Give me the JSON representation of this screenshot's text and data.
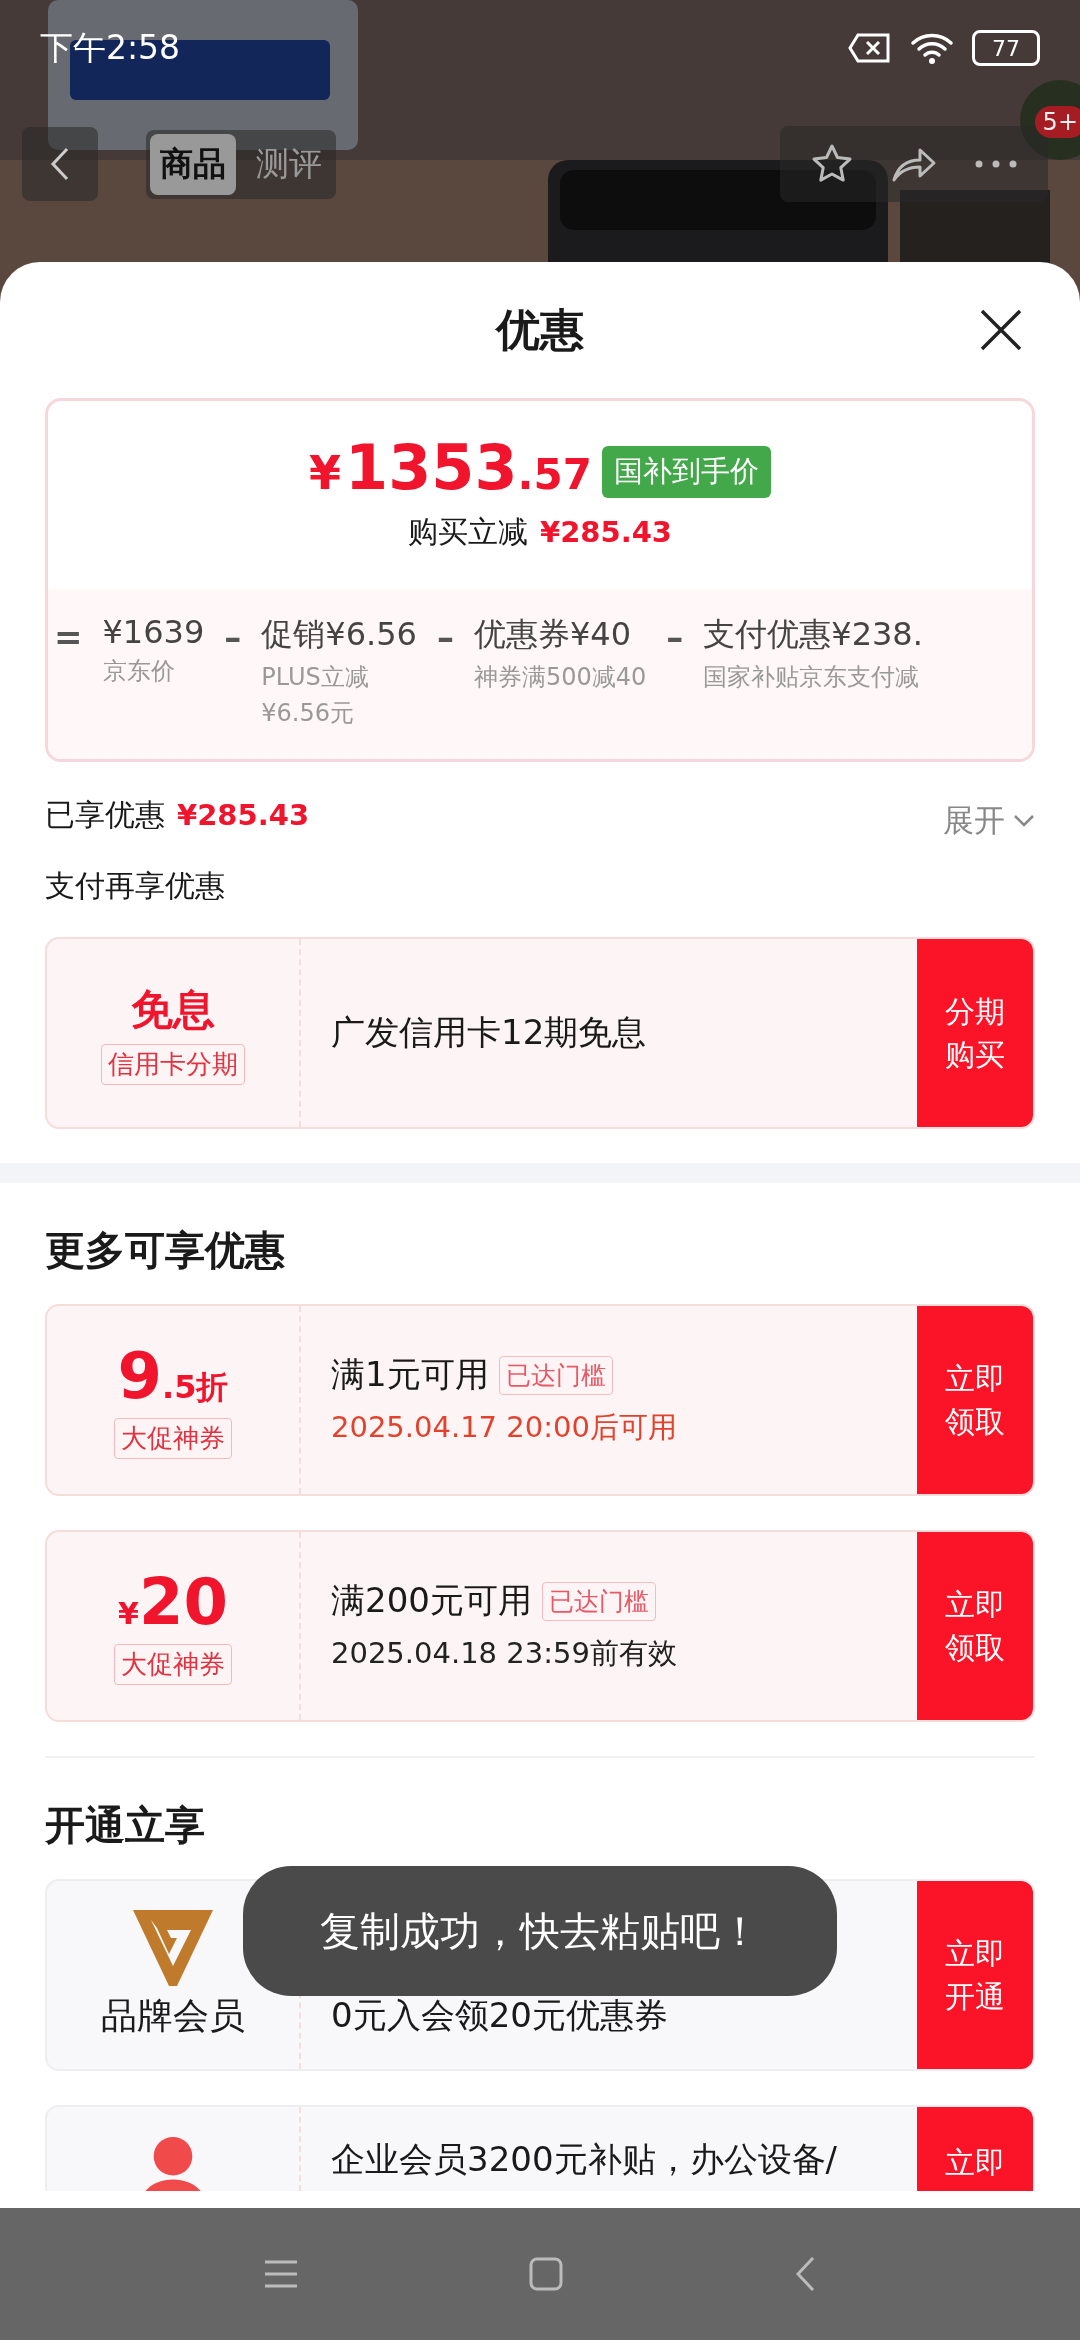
{
  "status_bar": {
    "time": "下午2:58",
    "battery": "77"
  },
  "header": {
    "tabs": [
      {
        "label": "商品",
        "selected": true
      },
      {
        "label": "测评",
        "selected": false
      }
    ],
    "badge": "5+"
  },
  "sheet": {
    "title": "优惠",
    "price": {
      "currency": "¥",
      "integer": "1353",
      "decimal": ".57",
      "tag": "国补到手价",
      "saving_label": "购买立减",
      "saving": "¥285.43"
    },
    "breakdown": [
      {
        "op": "=",
        "amount": "¥1639",
        "notes": [
          "京东价"
        ]
      },
      {
        "op": "–",
        "label": "促销",
        "amount": "¥6.56",
        "notes": [
          "PLUS立减",
          "¥6.56元"
        ]
      },
      {
        "op": "–",
        "label": "优惠券",
        "amount": "¥40",
        "notes": [
          "神券满500减40"
        ]
      },
      {
        "op": "–",
        "label": "支付优惠",
        "amount": "¥238.",
        "notes": [
          "国家补贴京东支付减"
        ]
      }
    ],
    "enjoyed": {
      "label": "已享优惠",
      "amount": "¥285.43",
      "toggle": "展开",
      "expanded": false
    },
    "pay_heading": "支付再享优惠",
    "pay_offers": [
      {
        "headline": "免息",
        "tag": "信用卡分期",
        "text": "广发信用卡12期免息",
        "button": "分期购买"
      }
    ],
    "more_heading": "更多可享优惠",
    "coupons": [
      {
        "main": "9",
        "suffix": ".5折",
        "tag": "大促神券",
        "title": "满1元可用",
        "badge": "已达门槛",
        "date": "2025.04.17 20:00后可用",
        "date_highlight": true,
        "button": "立即领取"
      },
      {
        "prefix": "¥",
        "main": "20",
        "tag": "大促神券",
        "title": "满200元可用",
        "badge": "已达门槛",
        "date": "2025.04.18 23:59前有效",
        "date_highlight": false,
        "button": "立即领取"
      }
    ],
    "member_heading": "开通立享",
    "memberships": [
      {
        "kind": "brand",
        "name": "品牌会员",
        "text": "0元入会领20元优惠券",
        "button": "立即开通"
      },
      {
        "kind": "enterprise",
        "text": "企业会员3200元补贴，办公设备/",
        "button": "立即"
      }
    ]
  },
  "toast": "复制成功，快去粘贴吧！"
}
